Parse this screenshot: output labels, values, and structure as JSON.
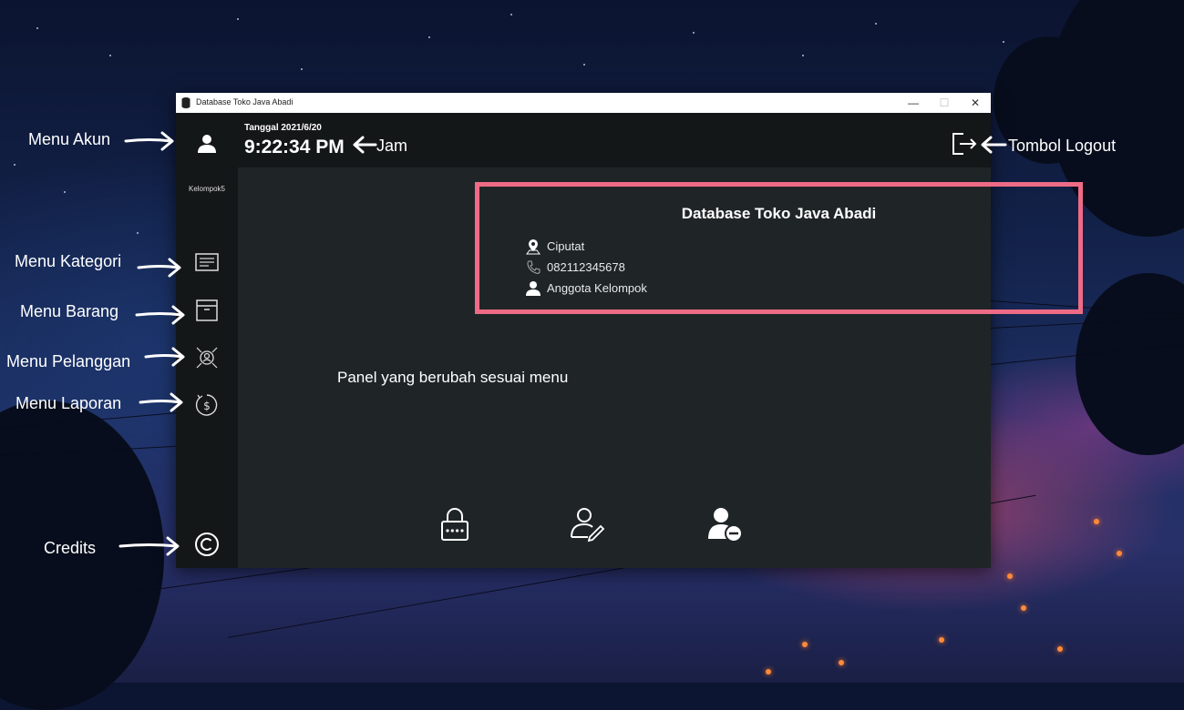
{
  "window": {
    "title": "Database Toko Java Abadi",
    "controls": {
      "minimize": "—",
      "maximize": "☐",
      "close": "✕"
    }
  },
  "sidebar": {
    "user_label": "Kelompok5",
    "items": [
      {
        "name": "menu-akun",
        "icon": "user-icon"
      },
      {
        "name": "menu-kategori",
        "icon": "list-card-icon"
      },
      {
        "name": "menu-barang",
        "icon": "box-icon"
      },
      {
        "name": "menu-pelanggan",
        "icon": "customer-network-icon"
      },
      {
        "name": "menu-laporan",
        "icon": "money-report-icon"
      },
      {
        "name": "credits",
        "icon": "copyright-icon"
      }
    ]
  },
  "header": {
    "date": "Tanggal 2021/6/20",
    "time": "9:22:34 PM"
  },
  "info_card": {
    "title": "Database Toko Java Abadi",
    "location": "Ciputat",
    "phone": "082112345678",
    "members": "Anggota Kelompok",
    "border_color": "#ee6b86"
  },
  "panel": {
    "text": "Panel yang berubah sesuai menu"
  },
  "bottom_actions": [
    {
      "icon": "lock-password-icon"
    },
    {
      "icon": "edit-user-icon"
    },
    {
      "icon": "remove-user-icon"
    }
  ],
  "annotations": {
    "menu_akun": "Menu Akun",
    "menu_kategori": "Menu Kategori",
    "menu_barang": "Menu Barang",
    "menu_pelanggan": "Menu Pelanggan",
    "menu_laporan": "Menu Laporan",
    "credits": "Credits",
    "jam": "Jam",
    "tombol_logout": "Tombol Logout"
  },
  "colors": {
    "sidebar_bg": "#141718",
    "content_bg": "#1f2527",
    "highlight_border": "#ee6b86"
  }
}
